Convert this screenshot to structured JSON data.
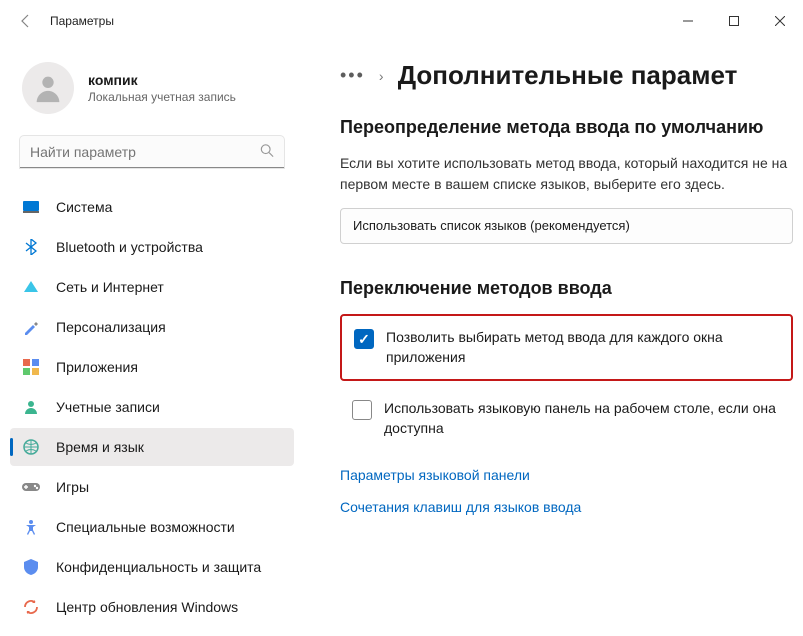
{
  "window": {
    "title": "Параметры"
  },
  "profile": {
    "name": "компик",
    "subtitle": "Локальная учетная запись"
  },
  "search": {
    "placeholder": "Найти параметр"
  },
  "nav": {
    "items": [
      {
        "label": "Система",
        "icon": "🖥️"
      },
      {
        "label": "Bluetooth и устройства",
        "icon": "bt"
      },
      {
        "label": "Сеть и Интернет",
        "icon": "net"
      },
      {
        "label": "Персонализация",
        "icon": "🖌️"
      },
      {
        "label": "Приложения",
        "icon": "apps"
      },
      {
        "label": "Учетные записи",
        "icon": "👤"
      },
      {
        "label": "Время и язык",
        "icon": "🌐"
      },
      {
        "label": "Игры",
        "icon": "🎮"
      },
      {
        "label": "Специальные возможности",
        "icon": "acc"
      },
      {
        "label": "Конфиденциальность и защита",
        "icon": "🛡️"
      },
      {
        "label": "Центр обновления Windows",
        "icon": "upd"
      }
    ],
    "active_index": 6
  },
  "main": {
    "page_title": "Дополнительные парамет",
    "section1": {
      "title": "Переопределение метода ввода по умолчанию",
      "desc": "Если вы хотите использовать метод ввода, который находится не на первом месте в вашем списке языков, выберите его здесь.",
      "select_value": "Использовать список языков (рекомендуется)"
    },
    "section2": {
      "title": "Переключение методов ввода",
      "check1": "Позволить выбирать метод ввода для каждого окна приложения",
      "check2": "Использовать языковую панель на рабочем столе, если она доступна",
      "link1": "Параметры языковой панели",
      "link2": "Сочетания клавиш для языков ввода"
    }
  }
}
